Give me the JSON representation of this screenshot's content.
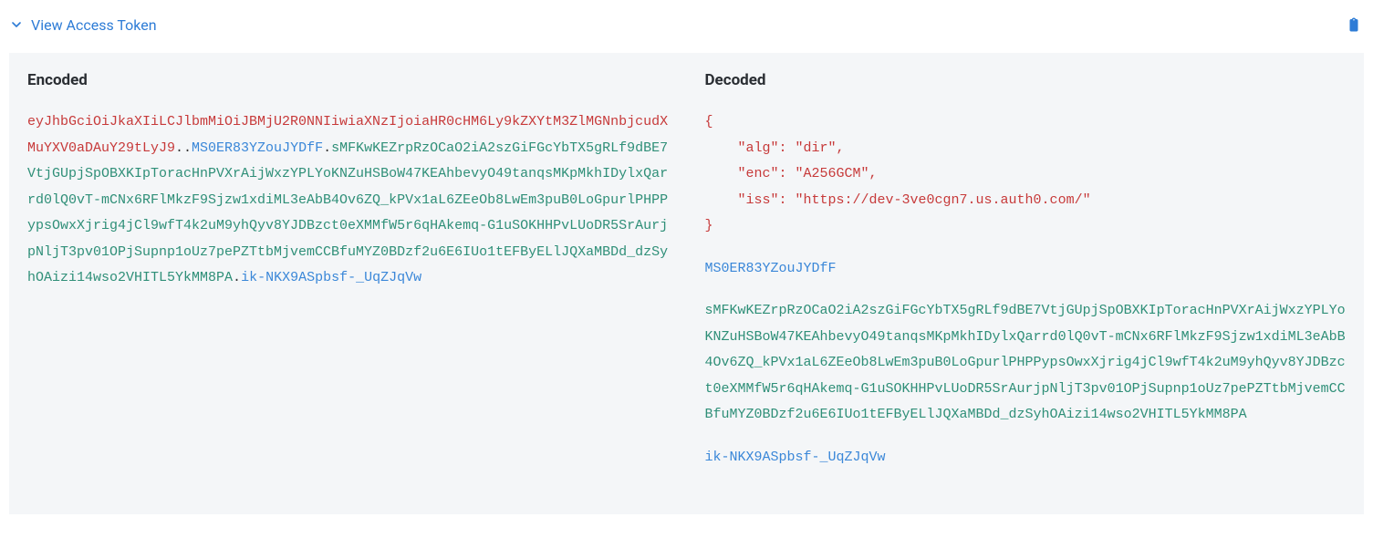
{
  "header": {
    "toggle_label": "View Access Token"
  },
  "encoded": {
    "title": "Encoded",
    "part1": "eyJhbGciOiJkaXIiLCJlbmMiOiJBMjU2R0NNIiwiaXNzIjoiaHR0cHM6Ly9kZXYtM3ZlMGNnbjcudXMuYXV0aDAuY29tLyJ9",
    "part2": "MS0ER83YZouJYDfF",
    "part3": "sMFKwKEZrpRzOCaO2iA2szGiFGcYbTX5gRLf9dBE7VtjGUpjSpOBXKIpToracHnPVXrAijWxzYPLYoKNZuHSBoW47KEAhbevyO49tanqsMKpMkhIDylxQarrd0lQ0vT-mCNx6RFlMkzF9Sjzw1xdiML3eAbB4Ov6ZQ_kPVx1aL6ZEeOb8LwEm3puB0LoGpurlPHPPypsOwxXjrig4jCl9wfT4k2uM9yhQyv8YJDBzct0eXMMfW5r6qHAkemq-G1uSOKHHPvLUoDR5SrAurjpNljT3pv01OPjSupnp1oUz7pePZTtbMjvemCCBfuMYZ0BDzf2u6E6IUo1tEFByELlJQXaMBDd_dzSyhOAizi14wso2VHITL5YkMM8PA",
    "part4": "ik-NKX9ASpbsf-_UqZJqVw"
  },
  "decoded": {
    "title": "Decoded",
    "json_lines": [
      "{",
      "    \"alg\": \"dir\",",
      "    \"enc\": \"A256GCM\",",
      "    \"iss\": \"https://dev-3ve0cgn7.us.auth0.com/\"",
      "}"
    ],
    "iv": "MS0ER83YZouJYDfF",
    "ciphertext": "sMFKwKEZrpRzOCaO2iA2szGiFGcYbTX5gRLf9dBE7VtjGUpjSpOBXKIpToracHnPVXrAijWxzYPLYoKNZuHSBoW47KEAhbevyO49tanqsMKpMkhIDylxQarrd0lQ0vT-mCNx6RFlMkzF9Sjzw1xdiML3eAbB4Ov6ZQ_kPVx1aL6ZEeOb8LwEm3puB0LoGpurlPHPPypsOwxXjrig4jCl9wfT4k2uM9yhQyv8YJDBzct0eXMMfW5r6qHAkemq-G1uSOKHHPvLUoDR5SrAurjpNljT3pv01OPjSupnp1oUz7pePZTtbMjvemCCBfuMYZ0BDzf2u6E6IUo1tEFByELlJQXaMBDd_dzSyhOAizi14wso2VHITL5YkMM8PA",
    "tag": "ik-NKX9ASpbsf-_UqZJqVw"
  }
}
